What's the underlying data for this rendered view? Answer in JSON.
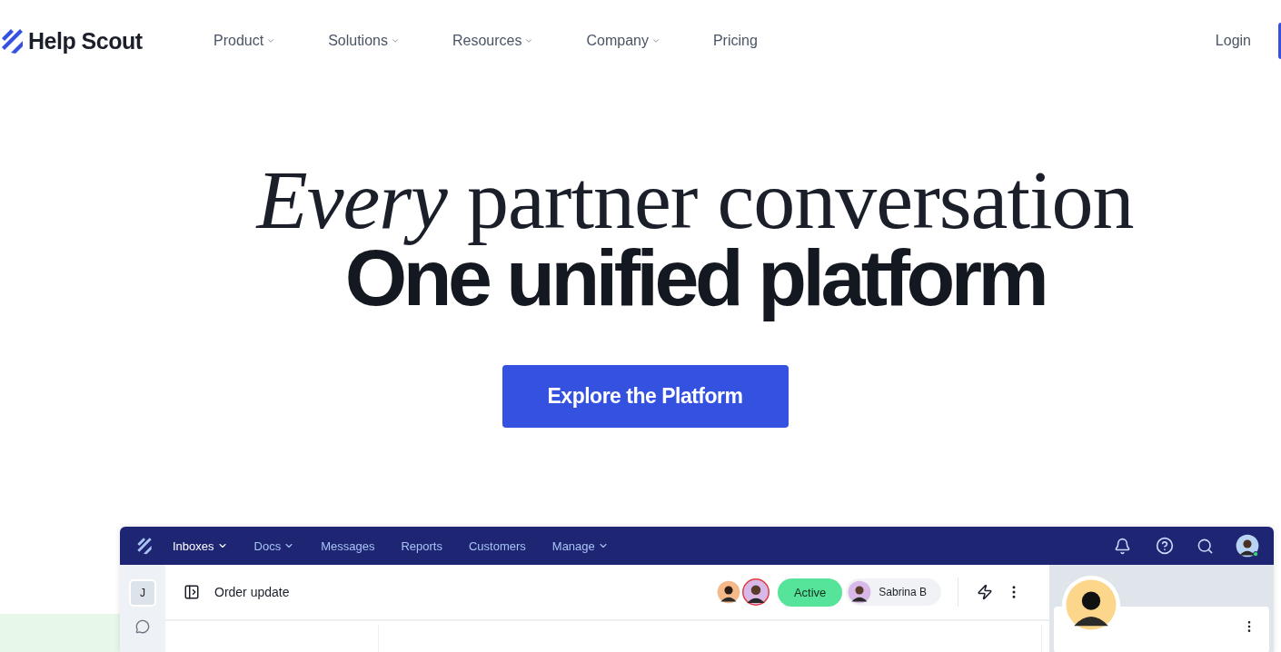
{
  "header": {
    "logo": "Help Scout",
    "nav": [
      {
        "label": "Product",
        "has_menu": true
      },
      {
        "label": "Solutions",
        "has_menu": true
      },
      {
        "label": "Resources",
        "has_menu": true
      },
      {
        "label": "Company",
        "has_menu": true
      },
      {
        "label": "Pricing",
        "has_menu": false
      }
    ],
    "login": "Login"
  },
  "hero": {
    "title_line_1": "*Every* partner conversation",
    "title_line_2": "One unified platform",
    "cta": "Explore the Platform"
  },
  "app": {
    "nav": [
      {
        "label": "Inboxes",
        "has_menu": true,
        "selected": true
      },
      {
        "label": "Docs",
        "has_menu": true,
        "selected": false
      },
      {
        "label": "Messages",
        "has_menu": false,
        "selected": false
      },
      {
        "label": "Reports",
        "has_menu": false,
        "selected": false
      },
      {
        "label": "Customers",
        "has_menu": false,
        "selected": false
      },
      {
        "label": "Manage",
        "has_menu": true,
        "selected": false
      }
    ],
    "rail_initial": "J",
    "conversation_title": "Order update",
    "status": "Active",
    "assignee": "Sabrina B"
  }
}
